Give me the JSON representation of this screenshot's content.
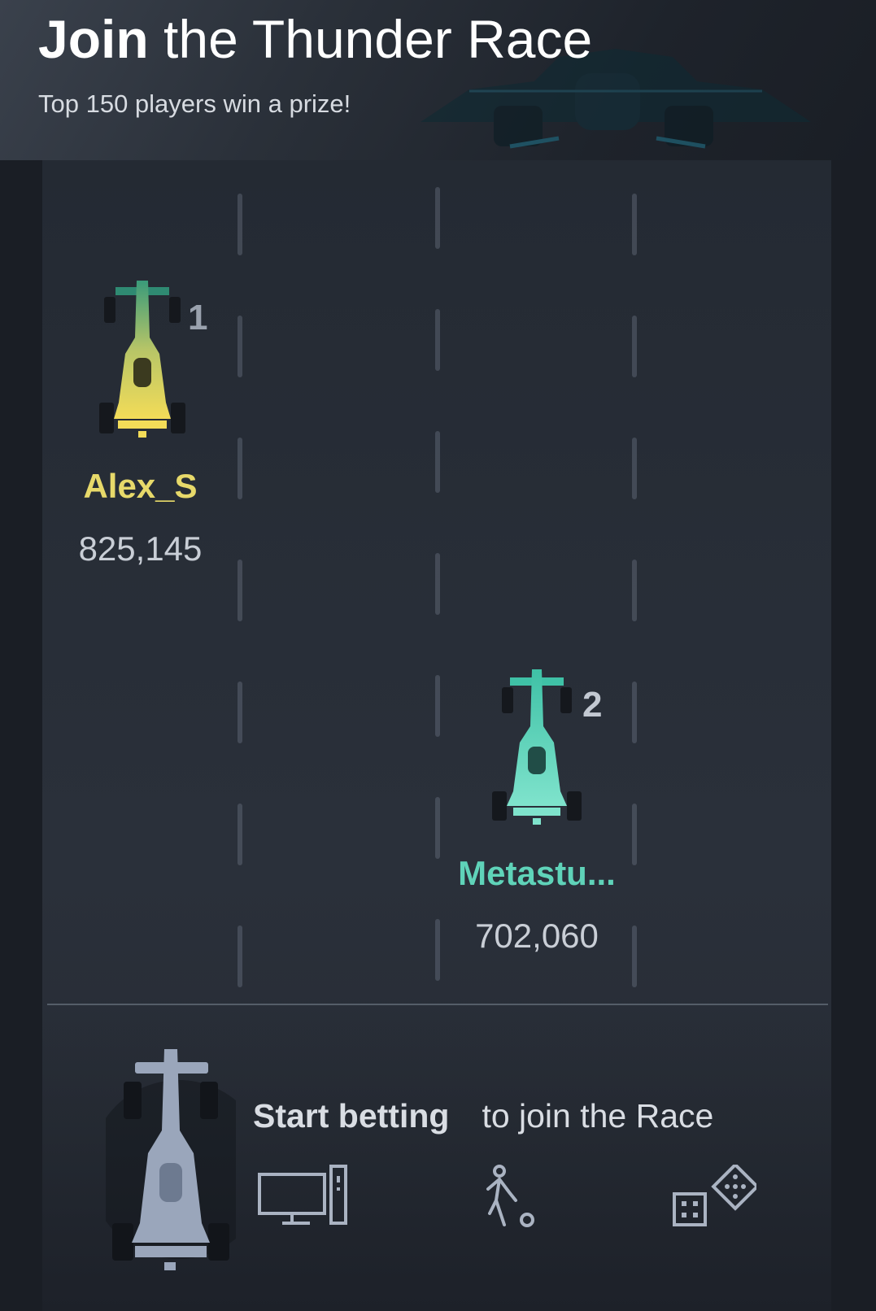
{
  "header": {
    "title_strong": "Join",
    "title_rest": "the Thunder Race",
    "subtitle": "Top 150 players win a prize!"
  },
  "leaderboard": [
    {
      "rank": "1",
      "name": "Alex_S",
      "score": "825,145",
      "color": "#e7d96a"
    },
    {
      "rank": "2",
      "name": "Metastu...",
      "score": "702,060",
      "color": "#5fd3b9"
    }
  ],
  "cta": {
    "bold": "Start betting",
    "rest": "to join the Race"
  },
  "icons": [
    "desktop-icon",
    "football-player-icon",
    "dice-icon"
  ],
  "colors": {
    "background": "#1b2029",
    "track": "#272d36",
    "gold": "#e7d96a",
    "teal": "#5fd3b9",
    "player_car": "#9aa6bb"
  }
}
